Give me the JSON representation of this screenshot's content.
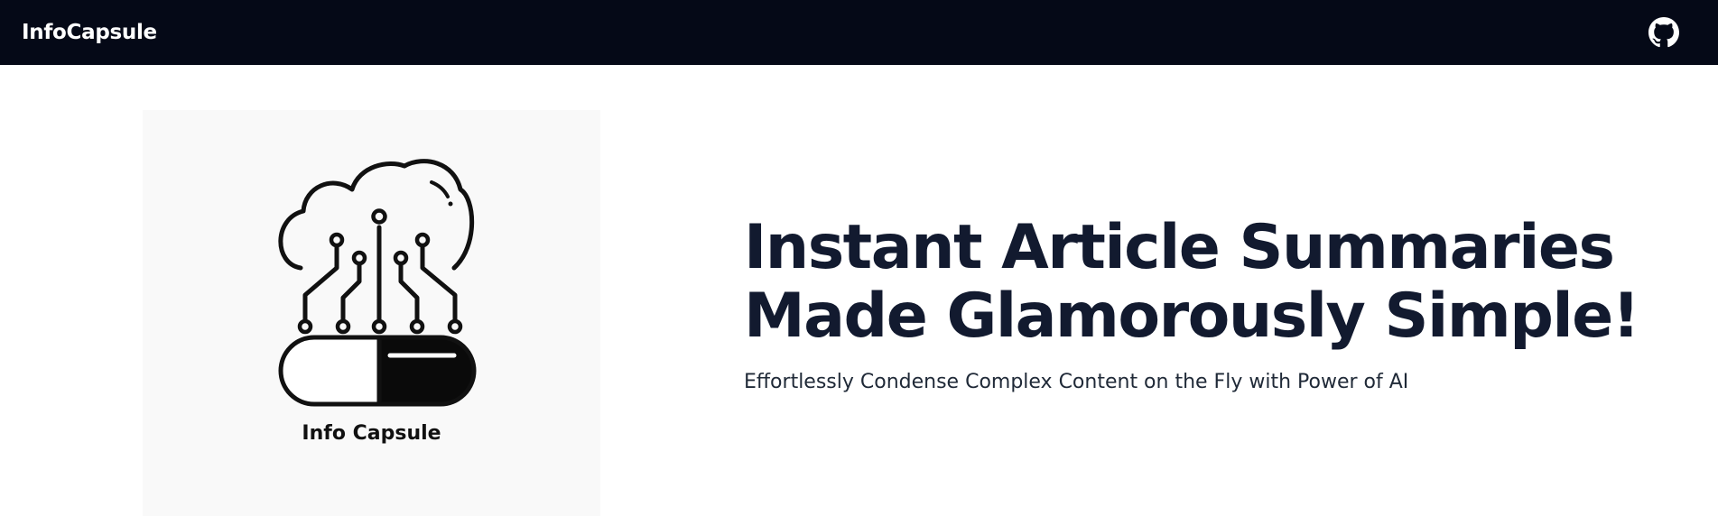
{
  "navbar": {
    "brand": "InfoCapsule",
    "github_icon": "github-icon",
    "background": "#050917"
  },
  "logo": {
    "caption": "Info Capsule",
    "icon": "cloud-circuit-capsule-logo"
  },
  "hero": {
    "headline_line1": "Instant Article Summaries",
    "headline_line2": "Made Glamorously Simple!",
    "subheadline": "Effortlessly Condense Complex Content on the Fly with Power of AI",
    "headline_color": "#121a2f"
  }
}
